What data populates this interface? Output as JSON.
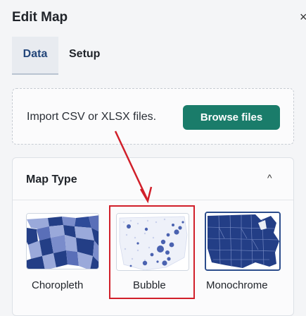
{
  "header": {
    "title": "Edit Map",
    "close_symbol": "×"
  },
  "tabs": [
    {
      "label": "Data",
      "active": true
    },
    {
      "label": "Setup",
      "active": false
    }
  ],
  "import": {
    "text": "Import CSV or XLSX files.",
    "button_label": "Browse files"
  },
  "map_type": {
    "label": "Map Type",
    "collapse_symbol": "^",
    "options": [
      {
        "label": "Choropleth",
        "selected": false
      },
      {
        "label": "Bubble",
        "selected": false
      },
      {
        "label": "Monochrome",
        "selected": true
      }
    ]
  },
  "colors": {
    "accent": "#1a7c6a",
    "active_tab_text": "#23467a",
    "highlight": "#d11f2a",
    "map_dark": "#233e86",
    "map_light": "#9aa9da"
  }
}
